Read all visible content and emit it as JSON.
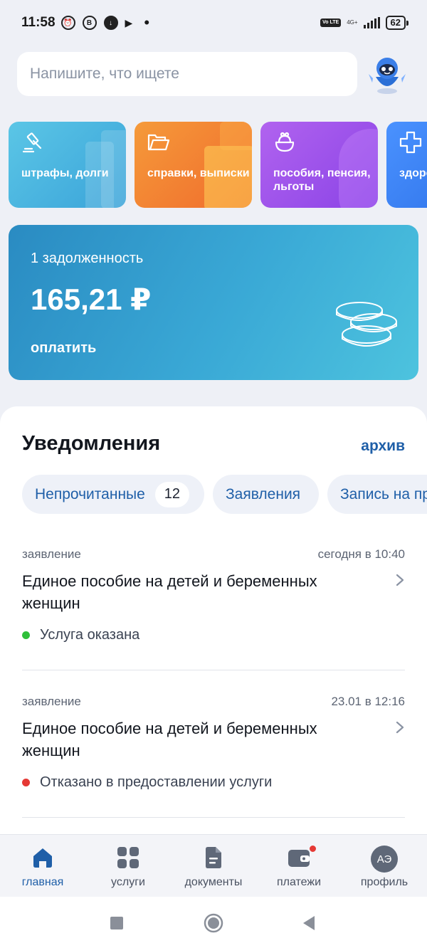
{
  "status_bar": {
    "time": "11:58",
    "dot": "•",
    "volte": "Vo LTE",
    "network": "4G+",
    "battery": "62"
  },
  "search": {
    "placeholder": "Напишите, что ищете",
    "assistant_icon": "robot-assistant-icon"
  },
  "tiles": [
    {
      "label": "штрафы, долги",
      "icon": "gavel-icon",
      "color": "#3aa3d9"
    },
    {
      "label": "справки, выписки",
      "icon": "folder-icon",
      "color": "#f06b2c"
    },
    {
      "label": "пособия, пенсия, льготы",
      "icon": "purse-icon",
      "color": "#8a43e6"
    },
    {
      "label": "здоровье",
      "icon": "plus-icon",
      "color": "#2c6fe6"
    }
  ],
  "debt": {
    "count_label": "1 задолженность",
    "amount": "165,21 ₽",
    "pay_label": "оплатить"
  },
  "notifications": {
    "title": "Уведомления",
    "archive_label": "архив",
    "chips": [
      {
        "label": "Непрочитанные",
        "badge": "12"
      },
      {
        "label": "Заявления"
      },
      {
        "label": "Запись на прием"
      }
    ],
    "items": [
      {
        "type": "заявление",
        "time": "сегодня в 10:40",
        "title": "Единое пособие на детей и беременных женщин",
        "status": "Услуга оказана",
        "status_color": "#2fbf3a"
      },
      {
        "type": "заявление",
        "time": "23.01 в 12:16",
        "title": "Единое пособие на детей и беременных женщин",
        "status": "Отказано в предоставлении услуги",
        "status_color": "#e53935"
      }
    ]
  },
  "bottom_nav": {
    "items": [
      {
        "label": "главная",
        "icon": "home-icon",
        "active": true
      },
      {
        "label": "услуги",
        "icon": "grid-icon"
      },
      {
        "label": "документы",
        "icon": "document-icon"
      },
      {
        "label": "платежи",
        "icon": "wallet-icon"
      },
      {
        "label": "профиль",
        "icon": "avatar",
        "initials": "АЭ"
      }
    ],
    "active_color": "#1f5fa8"
  }
}
